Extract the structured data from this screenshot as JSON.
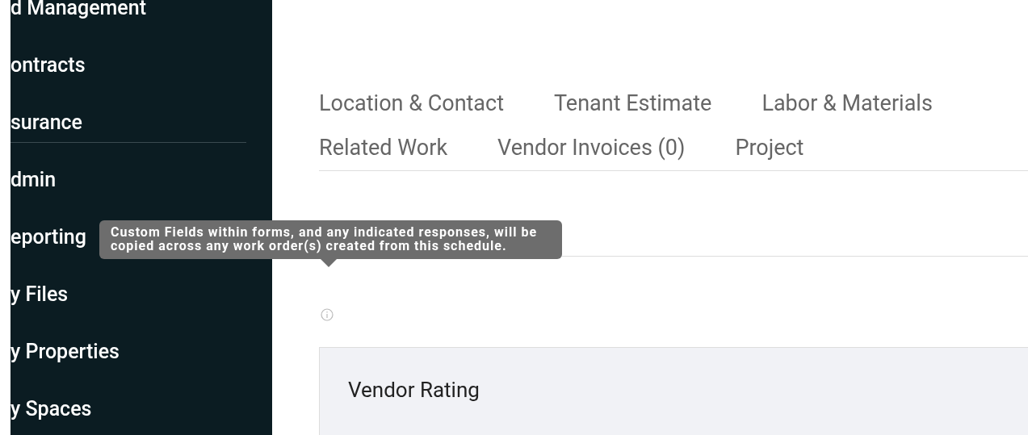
{
  "sidebar": {
    "groups": [
      {
        "items": [
          {
            "label": "d Management"
          },
          {
            "label": "ontracts"
          },
          {
            "label": "surance"
          }
        ]
      },
      {
        "items": [
          {
            "label": "dmin"
          },
          {
            "label": "eporting"
          },
          {
            "label": "y Files"
          },
          {
            "label": "y Properties"
          },
          {
            "label": "y Spaces"
          }
        ]
      }
    ]
  },
  "tab_rows": [
    {
      "tabs": [
        {
          "label": "Location & Contact"
        },
        {
          "label": "Tenant Estimate"
        },
        {
          "label": "Labor & Materials"
        }
      ]
    },
    {
      "tabs": [
        {
          "label": "Related Work"
        },
        {
          "label": "Vendor Invoices (0)"
        },
        {
          "label": "Project"
        }
      ]
    }
  ],
  "tooltip": {
    "text": "Custom Fields within forms, and any indicated responses, will be copied across any work order(s) created from this schedule."
  },
  "panel": {
    "title": "Vendor Rating"
  }
}
